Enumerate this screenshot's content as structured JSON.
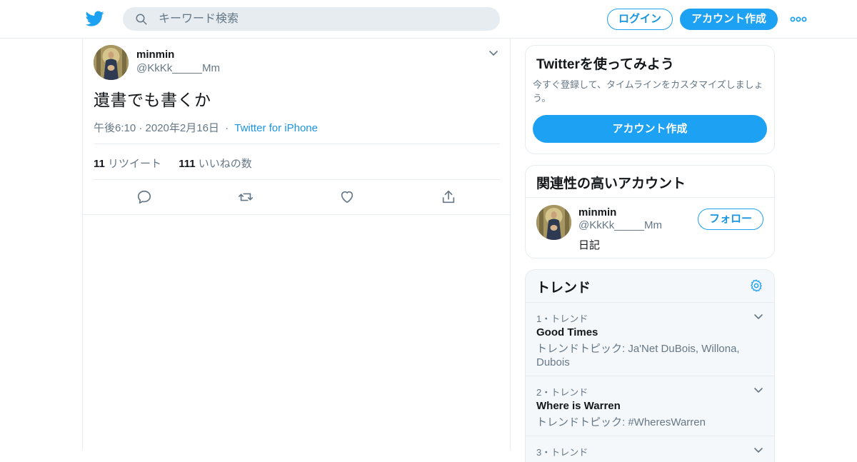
{
  "header": {
    "logo_icon": "twitter-bird-icon",
    "search_placeholder": "キーワード検索",
    "login_label": "ログイン",
    "signup_label": "アカウント作成",
    "more_icon": "more-horizontal-icon"
  },
  "tweet": {
    "author_name": "minmin",
    "author_handle": "@KkKk_____Mm",
    "text": "遺書でも書くか",
    "time": "午後6:10 · 2020年2月16日",
    "separator": "·",
    "source": "Twitter for iPhone",
    "retweets_count": "11",
    "retweets_label": "リツイート",
    "likes_count": "111",
    "likes_label": "いいねの数",
    "actions": [
      "reply-icon",
      "retweet-icon",
      "like-icon",
      "share-icon"
    ]
  },
  "sidebar": {
    "signup_card": {
      "title": "Twitterを使ってみよう",
      "description": "今すぐ登録して、タイムラインをカスタマイズしましょう。",
      "button_label": "アカウント作成"
    },
    "related_card": {
      "title": "関連性の高いアカウント",
      "account": {
        "name": "minmin",
        "handle": "@KkKk_____Mm",
        "bio": "日記",
        "follow_label": "フォロー"
      }
    },
    "trends_card": {
      "title": "トレンド",
      "settings_icon": "gear-icon",
      "items": [
        {
          "rank": "1・トレンド",
          "name": "Good Times",
          "topic": "トレンドトピック: Ja'Net DuBois, Willona, Dubois"
        },
        {
          "rank": "2・トレンド",
          "name": "Where is Warren",
          "topic": "トレンドトピック: #WheresWarren"
        },
        {
          "rank": "3・トレンド",
          "name": "",
          "topic": ""
        }
      ]
    }
  },
  "colors": {
    "accent": "#1da1f2",
    "link": "#1b95e0",
    "secondary_text": "#657786",
    "border": "#e6ecf0"
  }
}
